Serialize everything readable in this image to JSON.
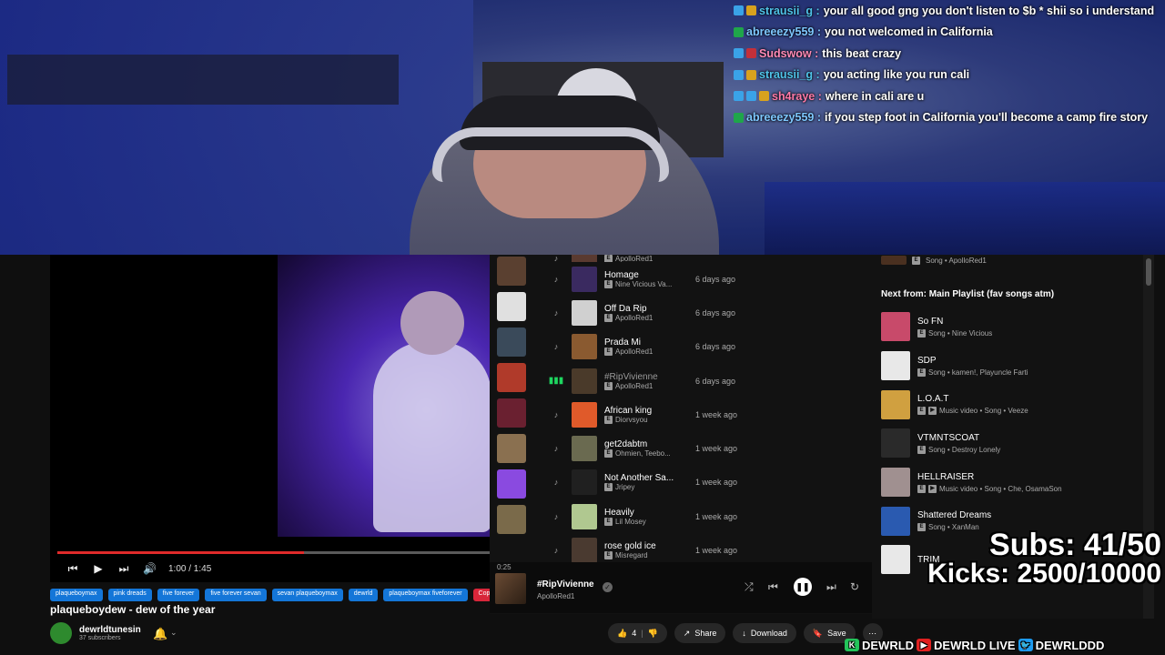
{
  "chat": [
    {
      "user": "strausii_g",
      "color": "#4fc3e8",
      "badges": [
        "b-blue",
        "b-gold"
      ],
      "message": "your all good gng you don't listen to $b * shii so i understand"
    },
    {
      "user": "abreeezy559",
      "color": "#7ec8ff",
      "badges": [
        "b-green"
      ],
      "message": "you not welcomed in California"
    },
    {
      "user": "Sudswow",
      "color": "#ff8ab5",
      "badges": [
        "b-blue",
        "b-red"
      ],
      "message": "this beat crazy"
    },
    {
      "user": "strausii_g",
      "color": "#4fc3e8",
      "badges": [
        "b-blue",
        "b-gold"
      ],
      "message": "you acting like you run cali"
    },
    {
      "user": "sh4raye",
      "color": "#ff7aa8",
      "badges": [
        "b-blue",
        "b-blue",
        "b-gold"
      ],
      "message": "where in cali are u"
    },
    {
      "user": "abreeezy559",
      "color": "#7ec8ff",
      "badges": [
        "b-green"
      ],
      "message": "if you step foot in California you'll become a camp fire story"
    }
  ],
  "player": {
    "time": "1:00 / 1:45",
    "progress": 0.57,
    "tags": [
      "plaqueboymax",
      "pink dreads",
      "five forever",
      "five forever sevan",
      "sevan plaqueboymax",
      "dewrld",
      "plaqueboymax fiveforever",
      "Copy Al"
    ],
    "title": "plaqueboydew - dew of the year",
    "channel": "dewrldtunesin",
    "subscribers": "37 subscribers"
  },
  "spotify": {
    "tracks": [
      {
        "name": "",
        "artist": "ApolloRed1",
        "date": "",
        "art": "#5a3a30"
      },
      {
        "name": "Homage",
        "artist": "Nine Vicious Va...",
        "date": "6 days ago",
        "art": "#3a2a60"
      },
      {
        "name": "Off Da Rip",
        "artist": "ApolloRed1",
        "date": "6 days ago",
        "art": "#d0d0d0"
      },
      {
        "name": "Prada Mi",
        "artist": "ApolloRed1",
        "date": "6 days ago",
        "art": "#8a5a30"
      },
      {
        "name": "#RipVivienne",
        "artist": "ApolloRed1",
        "date": "6 days ago",
        "art": "#4a3a2a",
        "playing": true
      },
      {
        "name": "African king",
        "artist": "Diorvsyou",
        "date": "1 week ago",
        "art": "#e05a2a"
      },
      {
        "name": "get2dabtm",
        "artist": "Ohmien, Teebo...",
        "date": "1 week ago",
        "art": "#6a6a50"
      },
      {
        "name": "Not Another Sa...",
        "artist": "Jripey",
        "date": "1 week ago",
        "art": "#202020"
      },
      {
        "name": "Heavily",
        "artist": "Lil Mosey",
        "date": "1 week ago",
        "art": "#b0c890"
      },
      {
        "name": "rose gold ice",
        "artist": "Misregard",
        "date": "1 week ago",
        "art": "#4a3a30"
      }
    ],
    "now_playing": {
      "time": "0:25",
      "title": "#RipVivienne",
      "artist": "ApolloRed1"
    }
  },
  "queue": {
    "prev_meta": "Song • ApolloRed1",
    "header": "Next from: Main Playlist (fav songs atm)",
    "items": [
      {
        "name": "So FN",
        "meta": "Song • Nine Vicious",
        "art": "#c84a6a",
        "video": false
      },
      {
        "name": "SDP",
        "meta": "Song • kamen!, Playuncle Farti",
        "art": "#e8e8e8",
        "video": false
      },
      {
        "name": "L.O.A.T",
        "meta": "Music video • Song • Veeze",
        "art": "#d0a040",
        "video": true
      },
      {
        "name": "VTMNTSCOAT",
        "meta": "Song • Destroy Lonely",
        "art": "#2a2a2a",
        "video": false
      },
      {
        "name": "HELLRAISER",
        "meta": "Music video • Song • Che, OsamaSon",
        "art": "#a09090",
        "video": true
      },
      {
        "name": "Shattered Dreams",
        "meta": "Song • XanMan",
        "art": "#2a5ab0",
        "video": false
      },
      {
        "name": "TRIM",
        "meta": "",
        "art": "#e8e8e8",
        "video": false
      }
    ]
  },
  "actions": {
    "likes": "4",
    "share": "Share",
    "download": "Download",
    "save": "Save"
  },
  "overlay": {
    "subs": "Subs: 41/50",
    "kicks": "Kicks: 2500/10000",
    "kick_handle": "DEWRLD",
    "yt_handle": "DEWRLD LIVE",
    "tw_handle": "DEWRLDDD"
  }
}
